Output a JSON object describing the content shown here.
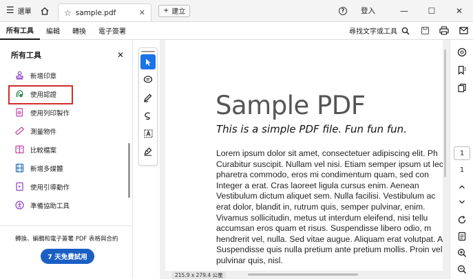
{
  "titlebar": {
    "menu_label": "選單",
    "tab_title": "sample.pdf",
    "new_tab_label": "建立",
    "sign_in_label": "登入"
  },
  "toolbar": {
    "menu_items": [
      "所有工具",
      "編輯",
      "轉換",
      "電子簽署"
    ],
    "search_label": "尋找文字或工具"
  },
  "left_panel": {
    "title": "所有工具",
    "items": [
      {
        "label": "新增印章",
        "icon": "stamp-icon"
      },
      {
        "label": "使用認證",
        "icon": "certificate-icon"
      },
      {
        "label": "使用列印製作",
        "icon": "print-production-icon"
      },
      {
        "label": "測量物件",
        "icon": "ruler-icon"
      },
      {
        "label": "比較檔案",
        "icon": "compare-icon"
      },
      {
        "label": "新增多媒體",
        "icon": "multimedia-icon"
      },
      {
        "label": "使用引導動作",
        "icon": "guided-action-icon"
      },
      {
        "label": "準備協助工具",
        "icon": "accessibility-icon"
      }
    ],
    "highlighted_item": "使用認證",
    "promo_text": "轉換、編輯和電子簽署 PDF 表格與合約",
    "trial_button": "7 天免費試用"
  },
  "document": {
    "title": "Sample PDF",
    "subtitle": "This is a simple PDF file. Fun fun fun.",
    "body_lines": [
      "Lorem ipsum dolor sit amet, consectetuer adipiscing elit. Ph",
      "Curabitur suscipit. Nullam vel nisi. Etiam semper ipsum ut lec",
      "pharetra commodo, eros mi condimentum quam, sed con",
      "Integer a erat. Cras laoreet ligula cursus enim. Aenean",
      "Vestibulum dictum aliquet sem. Nulla facilisi. Vestibulum ac",
      "erat dolor, blandit in, rutrum quis, semper pulvinar, enim.",
      "Vivamus sollicitudin, metus ut interdum eleifend, nisi tellu",
      "accumsan eros quam et risus. Suspendisse libero odio, m",
      "hendrerit vel, nulla. Sed vitae augue. Aliquam erat volutpat. A",
      "Suspendisse quis nulla pretium ante pretium mollis. Proin veli",
      "pulvinar quis, nisl."
    ],
    "page_size": "215.9 x 279.4 公厘"
  },
  "right_sidebar": {
    "current_page": "1",
    "total_pages": "1"
  },
  "colors": {
    "accent": "#1a73e8",
    "trial_button": "#1a5fc4",
    "highlight_border": "#d12b2b"
  }
}
